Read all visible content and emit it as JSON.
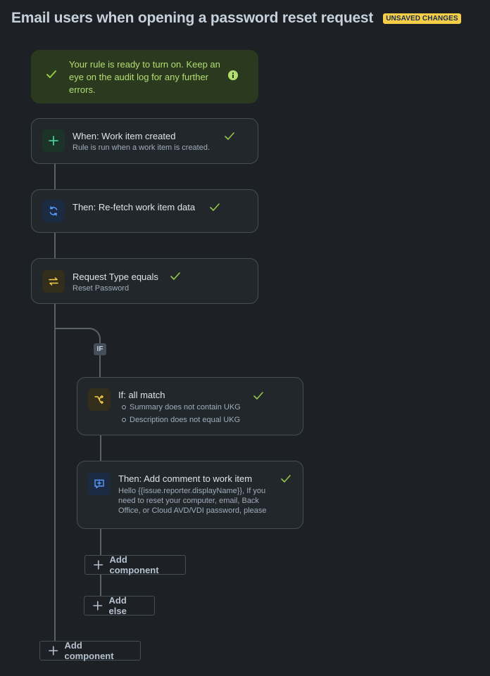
{
  "header": {
    "title": "Email users when opening a password reset request",
    "badge": "UNSAVED CHANGES"
  },
  "notice": {
    "text": "Your rule is ready to turn on. Keep an eye on the audit log for any further errors.",
    "icon": "info-icon",
    "status_icon": "check-icon"
  },
  "trigger": {
    "title": "When: Work item created",
    "subtitle": "Rule is run when a work item is created.",
    "icon": "plus-icon"
  },
  "refetch": {
    "title": "Then: Re-fetch work item data",
    "icon": "refresh-icon"
  },
  "condition": {
    "title": "Request Type equals",
    "subtitle": "Reset Password",
    "icon": "swap-icon"
  },
  "branch": {
    "label": "IF",
    "if_block": {
      "title": "If: all match",
      "conditions": [
        "Summary does not contain UKG",
        "Description does not equal UKG"
      ],
      "icon": "branch-icon"
    },
    "action": {
      "title": "Then: Add comment to work item",
      "body": "Hello {{issue.reporter.displayName}}, If you need to reset your computer, email, Back Office, or Cloud AVD/VDI password, please go to the self-service portal to reset",
      "icon": "comment-icon"
    },
    "add_component": "Add component",
    "add_else": "Add else"
  },
  "add_component": "Add component",
  "colors": {
    "background": "#1d2125",
    "card": "#22272b",
    "success": "#2b3a1f",
    "success_text": "#b3df72",
    "badge": "#f5cd47",
    "check": "#94c748"
  }
}
